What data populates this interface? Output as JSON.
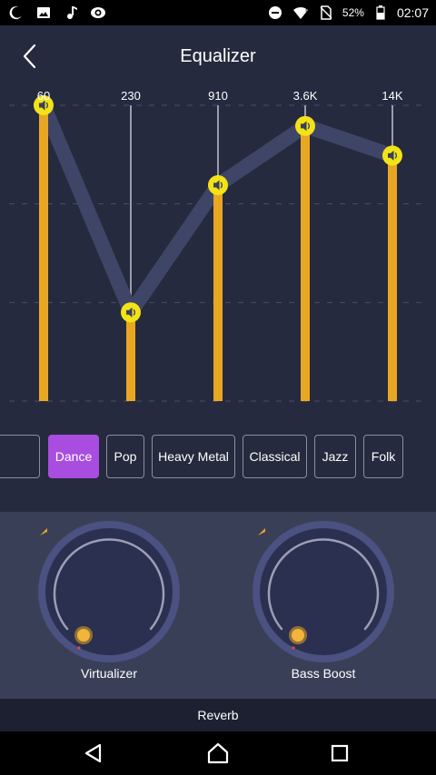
{
  "status_bar": {
    "battery_text": "52%",
    "time": "02:07",
    "left_icons": [
      "moon-icon",
      "image-icon",
      "music-note-icon",
      "eye-icon"
    ],
    "right_icons": [
      "dnd-icon",
      "wifi-icon",
      "no-sim-icon",
      "battery-icon"
    ]
  },
  "header": {
    "title": "Equalizer",
    "back_icon": "chevron-left-icon"
  },
  "equalizer": {
    "bands": [
      {
        "label": "60",
        "level": 1.0
      },
      {
        "label": "230",
        "level": 0.3
      },
      {
        "label": "910",
        "level": 0.73
      },
      {
        "label": "3.6K",
        "level": 0.93
      },
      {
        "label": "14K",
        "level": 0.83
      }
    ],
    "handle_icon": "speaker-icon",
    "colors": {
      "bar": "#e8a722",
      "line": "#3f4566",
      "handle": "#f2e317",
      "track": "#9a9cac"
    }
  },
  "presets": {
    "items": [
      "",
      "Dance",
      "Pop",
      "Heavy Metal",
      "Classical",
      "Jazz",
      "Folk"
    ],
    "selected": "Dance",
    "accent": "#a94de0"
  },
  "knobs": [
    {
      "label": "Virtualizer",
      "level": 0.0
    },
    {
      "label": "Bass Boost",
      "level": 0.0
    }
  ],
  "reverb": {
    "label": "Reverb"
  },
  "navbar": {
    "icons": [
      "back-triangle-icon",
      "home-icon",
      "recents-square-icon"
    ]
  }
}
